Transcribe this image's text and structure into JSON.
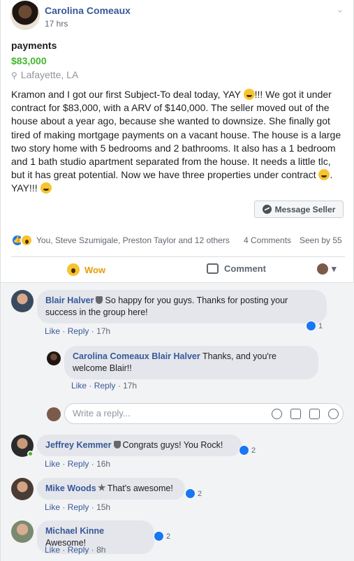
{
  "post": {
    "author": "Carolina Comeaux",
    "time": "17 hrs",
    "title": "payments",
    "price": "$83,000",
    "location": "Lafayette, LA",
    "body_1": "Kramon and I got our first Subject-To deal today, YAY ",
    "body_2": "!!! We got it under contract for $83,000, with a ARV of $140,000. The seller moved out of the house about a year ago, because she wanted to downsize. She finally got tired of making mortgage payments on a vacant house. The house is a large two story home with 5 bedrooms and 2 bathrooms. It also has a 1 bedroom and 1 bath studio apartment separated from the house. It needs a little tlc, but it has great potential. Now we have three properties under contract ",
    "body_3": ". YAY!!! ",
    "message_button": "Message Seller"
  },
  "stats": {
    "names": "You, Steve Szumigale, Preston Taylor and 12 others",
    "comments": "4 Comments",
    "seen": "Seen by 55"
  },
  "actions": {
    "wow": "Wow",
    "comment": "Comment"
  },
  "comments": [
    {
      "name": "Blair Halver",
      "text": "So happy for you guys. Thanks for posting your success in the group here!",
      "like": "Like",
      "reply": "Reply",
      "time": "17h",
      "count": "1"
    },
    {
      "name": "Carolina Comeaux",
      "tag": "Blair Halver",
      "text": "Thanks, and you're welcome Blair!!",
      "like": "Like",
      "reply": "Reply",
      "time": "17h"
    },
    {
      "name": "Jeffrey Kemmer",
      "text": "Congrats guys! You Rock!",
      "like": "Like",
      "reply": "Reply",
      "time": "16h",
      "count": "2"
    },
    {
      "name": "Mike Woods",
      "text": "That's awesome!",
      "like": "Like",
      "reply": "Reply",
      "time": "15h",
      "count": "2"
    },
    {
      "name": "Michael Kinne",
      "text": "Awesome!",
      "like": "Like",
      "reply": "Reply",
      "time": "8h",
      "count": "2"
    }
  ],
  "reply_placeholder": "Write a reply...",
  "dot": "·"
}
